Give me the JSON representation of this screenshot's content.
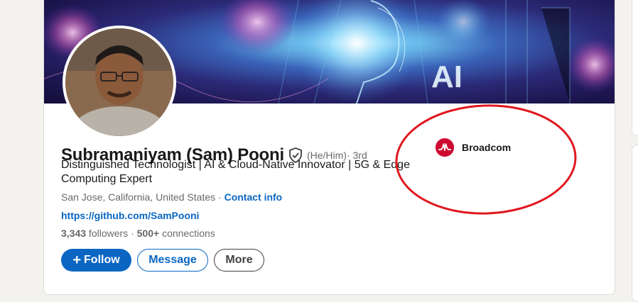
{
  "profile": {
    "name": "Subramaniyam (Sam) Pooni",
    "pronouns": "(He/Him)",
    "degree": " · 3rd",
    "headline": "Distinguished Technologist | AI & Cloud-Native Innovator | 5G & Edge Computing Expert",
    "location": "San Jose, California, United States",
    "separator": " · ",
    "contact_info": "Contact info",
    "website": "https://github.com/SamPooni",
    "followers_count": "3,343",
    "followers_label": " followers",
    "stats_separator": " · ",
    "connections_count": "500+",
    "connections_label": " connections"
  },
  "banner": {
    "text": "AI"
  },
  "buttons": {
    "follow": "Follow",
    "follow_icon": "+",
    "message": "Message",
    "more": "More"
  },
  "company": {
    "name": "Broadcom"
  },
  "colors": {
    "brand_blue": "#0a66c2",
    "annotation_red": "#e0171f",
    "broadcom_red": "#cc092f"
  },
  "icons": [
    "verified-shield-icon",
    "plus-icon",
    "broadcom-logo-icon"
  ]
}
